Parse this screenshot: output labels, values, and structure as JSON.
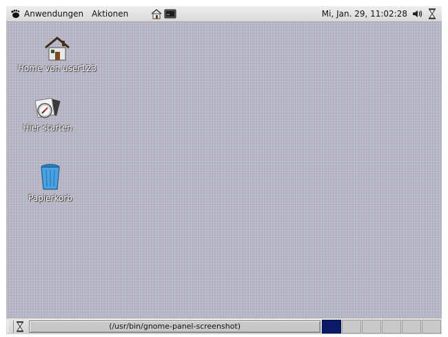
{
  "top_panel": {
    "menus": [
      {
        "label": "Anwendungen",
        "icon": "gnome-foot-icon"
      },
      {
        "label": "Aktionen"
      }
    ],
    "launchers": [
      "home-launcher-icon",
      "terminal-launcher-icon"
    ],
    "clock": "Mi, Jan. 29, 11:02:28",
    "tray_icons": [
      "volume-icon",
      "hourglass-icon"
    ]
  },
  "desktop": {
    "icons": [
      {
        "label": "Home von user123",
        "icon": "home-folder-icon"
      },
      {
        "label": "Hier starten",
        "icon": "start-here-icon"
      },
      {
        "label": "Papierkorb",
        "icon": "trash-icon"
      }
    ]
  },
  "bottom_panel": {
    "task": "(/usr/bin/gnome-panel-screenshot)",
    "workspaces_count": 6,
    "active_workspace": 1
  },
  "colors": {
    "desktop_bg": "#b7b6c6",
    "panel_bg": "#dcdcdc",
    "active_workspace": "#0b1a66"
  }
}
